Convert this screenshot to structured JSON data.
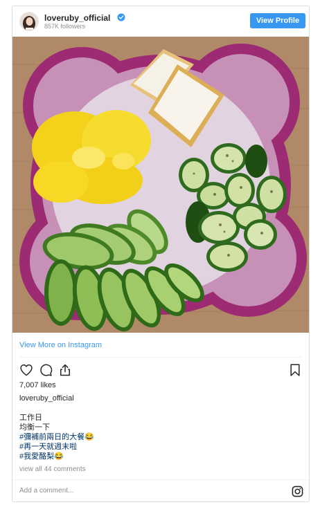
{
  "header": {
    "username": "loveruby_official",
    "followers": "857K followers",
    "view_profile_label": "View Profile"
  },
  "icons": {
    "verified": "verified-badge-icon",
    "like": "heart-icon",
    "comment": "comment-bubble-icon",
    "share": "share-icon",
    "save": "bookmark-icon",
    "instagram": "instagram-logo-icon"
  },
  "colors": {
    "accent": "#3897f0",
    "hashtag": "#003569",
    "muted": "#8e8e8e",
    "text": "#262626"
  },
  "post": {
    "view_more_label": "View More on Instagram",
    "likes": "7,007 likes",
    "caption_username": "loveruby_official",
    "caption_lines": [
      {
        "text": "工作日",
        "is_hashtag": false
      },
      {
        "text": "均衡一下",
        "is_hashtag": false
      },
      {
        "text": "#彌補前兩日的大餐😂",
        "is_hashtag": true
      },
      {
        "text": "#再一天就週末啦",
        "is_hashtag": true
      },
      {
        "text": "#我愛酪梨😂",
        "is_hashtag": true
      }
    ],
    "comments_link": "view all 44 comments"
  },
  "comment_box": {
    "placeholder": "Add a comment..."
  }
}
